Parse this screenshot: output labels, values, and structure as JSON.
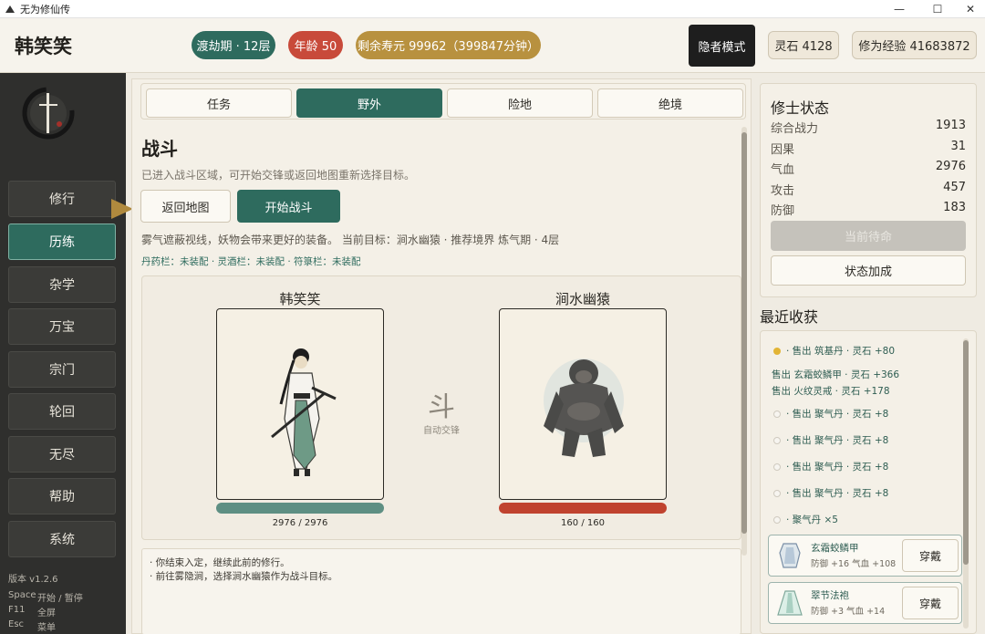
{
  "window": {
    "title": "无为修仙传"
  },
  "header": {
    "player_name": "韩笑笑",
    "realm": "渡劫期 · 12层",
    "age": "年龄 50",
    "lifespan": "剩余寿元 99962（399847分钟）",
    "hermit_mode": "隐者模式",
    "spirit_stone": "灵石 4128",
    "cultivation_exp": "修为经验 41683872",
    "colors": {
      "realm": "#2e6b5e",
      "age": "#c84a3a",
      "lifespan": "#b8913f",
      "accent": "#2e6b5e"
    }
  },
  "sidebar": {
    "items": [
      {
        "label": "修行",
        "active": false
      },
      {
        "label": "历练",
        "active": true
      },
      {
        "label": "杂学",
        "active": false
      },
      {
        "label": "万宝",
        "active": false
      },
      {
        "label": "宗门",
        "active": false
      },
      {
        "label": "轮回",
        "active": false
      },
      {
        "label": "无尽",
        "active": false
      },
      {
        "label": "帮助",
        "active": false
      },
      {
        "label": "系统",
        "active": false
      }
    ],
    "version": "版本 v1.2.6",
    "shortcuts": [
      {
        "key": "Space",
        "action": "开始 / 暂停"
      },
      {
        "key": "F11",
        "action": "全屏"
      },
      {
        "key": "Esc",
        "action": "菜单"
      }
    ]
  },
  "tabs": [
    {
      "label": "任务",
      "active": false
    },
    {
      "label": "野外",
      "active": true
    },
    {
      "label": "险地",
      "active": false
    },
    {
      "label": "绝境",
      "active": false
    }
  ],
  "battle": {
    "title": "战斗",
    "description": "已进入战斗区域，可开始交锋或返回地图重新选择目标。",
    "back_button": "返回地图",
    "start_button": "开始战斗",
    "info_line": "雾气遮蔽视线，妖物会带来更好的装备。    当前目标：涧水幽猿    ·    推荐境界 炼气期 · 4层",
    "slots": "丹药栏：未装配    ·    灵酒栏：未装配    ·    符箓栏：未装配",
    "player": {
      "name": "韩笑笑",
      "hp_text": "2976 / 2976",
      "hp_fraction": 1.0,
      "bar_color": "#5e8f83"
    },
    "enemy": {
      "name": "涧水幽猿",
      "hp_text": "160 / 160",
      "hp_fraction": 1.0,
      "bar_color": "#c0432f"
    },
    "vs_char": "斗",
    "vs_label": "自动交锋",
    "log": [
      "· 你结束入定，继续此前的修行。",
      "· 前往雾隐涧，选择涧水幽猿作为战斗目标。"
    ]
  },
  "status": {
    "title": "修士状态",
    "rows": [
      {
        "label": "综合战力",
        "value": "1913"
      },
      {
        "label": "因果",
        "value": "31"
      },
      {
        "label": "气血",
        "value": "2976"
      },
      {
        "label": "攻击",
        "value": "457"
      },
      {
        "label": "防御",
        "value": "183"
      }
    ],
    "disabled_button": "当前待命",
    "buff_button": "状态加成"
  },
  "recent": {
    "title": "最近收获",
    "items": [
      {
        "icon": "gold-pill-icon",
        "text": "· 售出 筑基丹 · 灵石 +80"
      },
      {
        "icon": "",
        "text": "售出 玄霜蛟鳞甲 · 灵石 +366"
      },
      {
        "icon": "",
        "text": "售出 火纹灵戒 · 灵石 +178"
      },
      {
        "icon": "white-pill-icon",
        "text": "· 售出 聚气丹 · 灵石 +8"
      },
      {
        "icon": "white-pill-icon",
        "text": "· 售出 聚气丹 · 灵石 +8"
      },
      {
        "icon": "white-pill-icon",
        "text": "· 售出 聚气丹 · 灵石 +8"
      },
      {
        "icon": "white-pill-icon",
        "text": "· 售出 聚气丹 · 灵石 +8"
      },
      {
        "icon": "white-pill-icon",
        "text": "· 聚气丹 ×5"
      }
    ],
    "equipment": [
      {
        "name": "玄霜蛟鳞甲",
        "stats": "防御 +16    气血 +108",
        "button": "穿戴",
        "icon": "armor-icon"
      },
      {
        "name": "翠节法袍",
        "stats": "防御 +3    气血 +14",
        "button": "穿戴",
        "icon": "robe-icon"
      }
    ]
  }
}
